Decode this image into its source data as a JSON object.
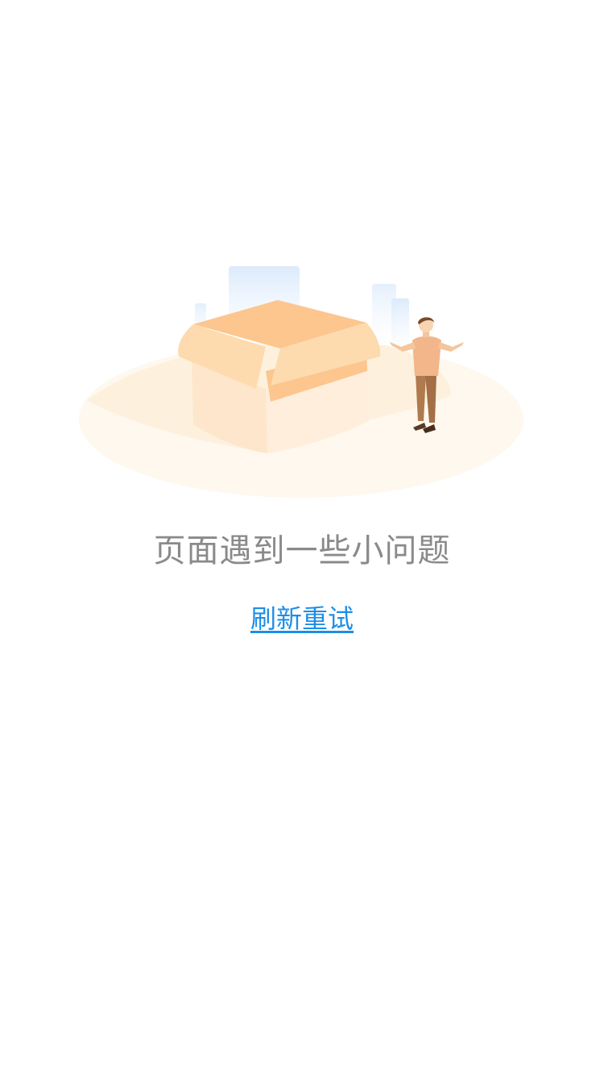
{
  "error": {
    "message": "页面遇到一些小问题",
    "illustration_icon": "empty-box-illustration"
  },
  "actions": {
    "retry_label": "刷新重试"
  },
  "colors": {
    "message_text": "#8a8a8a",
    "link": "#1c8ee8",
    "box_top": "#fcc68e",
    "box_side": "#fde3c4",
    "ground": "#fef7ec"
  }
}
